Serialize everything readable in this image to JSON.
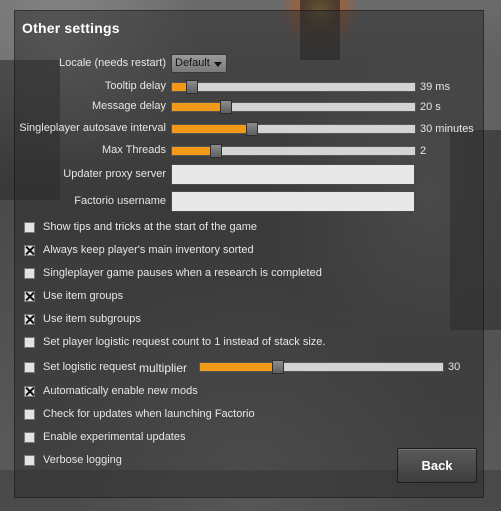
{
  "panel": {
    "title": "Other settings"
  },
  "locale": {
    "label": "Locale (needs restart)",
    "value": "Default"
  },
  "tooltip_delay": {
    "label": "Tooltip delay",
    "value_text": "39 ms",
    "fill": 0.06
  },
  "message_delay": {
    "label": "Message delay",
    "value_text": "20 s",
    "fill": 0.2
  },
  "autosave": {
    "label": "Singleplayer autosave interval",
    "value_text": "30 minutes",
    "fill": 0.31
  },
  "max_threads": {
    "label": "Max Threads",
    "value_text": "2",
    "fill": 0.16
  },
  "proxy": {
    "label": "Updater proxy server",
    "value": ""
  },
  "username": {
    "label": "Factorio username",
    "value": ""
  },
  "checkboxes": [
    {
      "label": "Show tips and tricks at the start of the game",
      "checked": false
    },
    {
      "label": "Always keep player's main inventory sorted",
      "checked": true
    },
    {
      "label": "Singleplayer game pauses when a research is completed",
      "checked": false
    },
    {
      "label": "Use item groups",
      "checked": true
    },
    {
      "label": "Use item subgroups",
      "checked": true
    },
    {
      "label": "Set player logistic request count to 1 instead of stack size.",
      "checked": false
    },
    {
      "label": "Set logistic request",
      "checked": false
    },
    {
      "label": "Automatically enable new mods",
      "checked": true
    },
    {
      "label": "Check for updates when launching Factorio",
      "checked": false
    },
    {
      "label": "Enable experimental updates",
      "checked": false
    },
    {
      "label": "Verbose logging",
      "checked": false
    }
  ],
  "multiplier": {
    "label": "multiplier",
    "value_text": "30",
    "fill": 0.3
  },
  "back_label": "Back",
  "colors": {
    "accent": "#f19a1a",
    "panel": "#2d2d2d"
  }
}
